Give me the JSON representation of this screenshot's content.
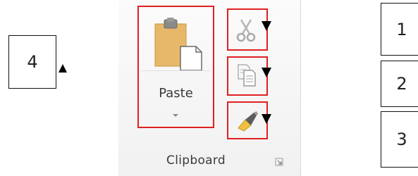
{
  "ribbon": {
    "group_label": "Clipboard",
    "paste": {
      "label": "Paste",
      "dropdown": true
    },
    "buttons": [
      {
        "name": "cut",
        "icon": "scissors-icon"
      },
      {
        "name": "copy",
        "icon": "copy-icon"
      },
      {
        "name": "format-painter",
        "icon": "paintbrush-icon"
      }
    ]
  },
  "callouts": {
    "box_4": "4",
    "box_1": "1",
    "box_2": "2",
    "box_3": "3"
  },
  "colors": {
    "highlight": "#e02020",
    "clipboard": "#e8b86a",
    "brush": "#f0c040"
  }
}
